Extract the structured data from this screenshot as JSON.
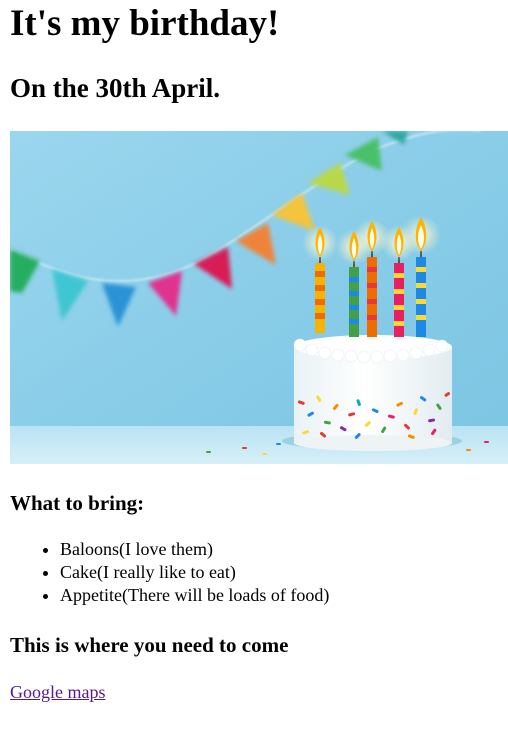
{
  "page": {
    "title": "It's my birthday!",
    "date_heading": "On the 30th April.",
    "bring_heading": "What to bring:",
    "bring_items": [
      "Baloons(I love them)",
      "Cake(I really like to eat)",
      "Appetite(There will be loads of food)"
    ],
    "location_heading": "This is where you need to come",
    "map_link_label": "Google maps"
  },
  "photo": {
    "subject": "birthday-cake-with-candles-and-bunting",
    "candle_count": 5
  },
  "colors": {
    "text": "#000000",
    "visited_link": "#551a8b",
    "photo_background": "#8fd0ea",
    "cake_frosting": "#f8f8f8"
  }
}
